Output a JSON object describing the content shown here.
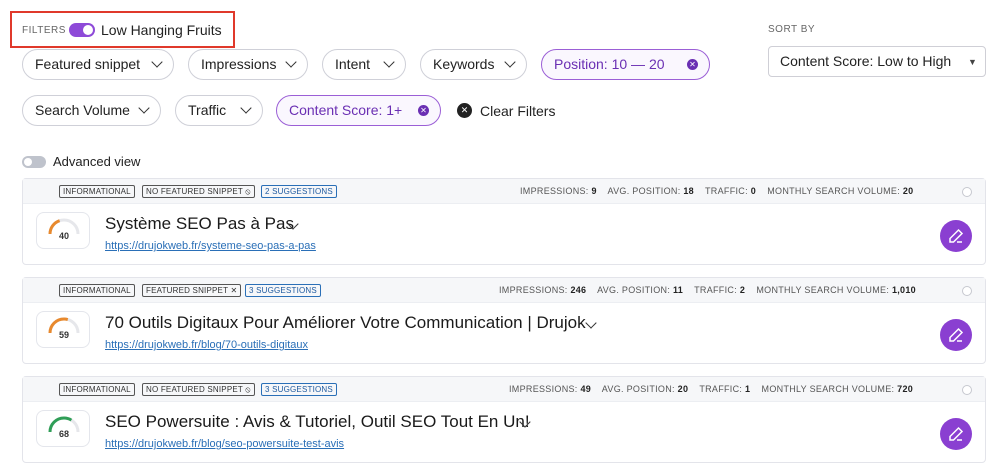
{
  "filters": {
    "label": "FILTERS",
    "low_hanging_fruits": {
      "label": "Low Hanging Fruits",
      "enabled": true
    }
  },
  "sort": {
    "label": "SORT BY",
    "selected": "Content Score: Low to High"
  },
  "chips": [
    {
      "label": "Featured snippet",
      "active": false
    },
    {
      "label": "Impressions",
      "active": false
    },
    {
      "label": "Intent",
      "active": false
    },
    {
      "label": "Keywords",
      "active": false
    },
    {
      "label": "Position: 10 — 20",
      "active": true
    },
    {
      "label": "Search Volume",
      "active": false
    },
    {
      "label": "Traffic",
      "active": false
    },
    {
      "label": "Content Score: 1+",
      "active": true
    }
  ],
  "clear_filters": "Clear Filters",
  "advanced_view": {
    "label": "Advanced view",
    "enabled": false
  },
  "metric_labels": {
    "impressions": "IMPRESSIONS:",
    "avg_position": "AVG. POSITION:",
    "traffic": "TRAFFIC:",
    "monthly_search_volume": "MONTHLY SEARCH VOLUME:"
  },
  "rows": [
    {
      "intent": "INFORMATIONAL",
      "snippet": "NO FEATURED SNIPPET ⦸",
      "suggestions": "2 SUGGESTIONS",
      "impressions": "9",
      "avg_position": "18",
      "traffic": "0",
      "monthly_search_volume": "20",
      "score": "40",
      "score_fraction": 0.4,
      "score_color": "#e8892d",
      "title": "Système SEO Pas à Pas",
      "url": "https://drujokweb.fr/systeme-seo-pas-a-pas"
    },
    {
      "intent": "INFORMATIONAL",
      "snippet": "FEATURED SNIPPET ✕",
      "suggestions": "3 SUGGESTIONS",
      "impressions": "246",
      "avg_position": "11",
      "traffic": "2",
      "monthly_search_volume": "1,010",
      "score": "59",
      "score_fraction": 0.59,
      "score_color": "#e8892d",
      "title": "70 Outils Digitaux Pour Améliorer Votre Communication | Drujok",
      "url": "https://drujokweb.fr/blog/70-outils-digitaux"
    },
    {
      "intent": "INFORMATIONAL",
      "snippet": "NO FEATURED SNIPPET ⦸",
      "suggestions": "3 SUGGESTIONS",
      "impressions": "49",
      "avg_position": "20",
      "traffic": "1",
      "monthly_search_volume": "720",
      "score": "68",
      "score_fraction": 0.68,
      "score_color": "#2f9e57",
      "title": "SEO Powersuite : Avis & Tutoriel, Outil SEO Tout En Un!",
      "url": "https://drujokweb.fr/blog/seo-powersuite-test-avis"
    }
  ]
}
